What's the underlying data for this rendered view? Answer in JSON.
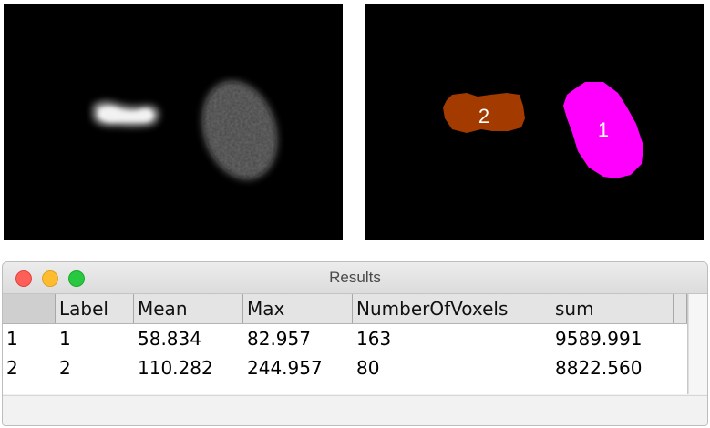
{
  "panels": {
    "raw": {
      "description_icon": "grayscale-image"
    },
    "labels": {
      "objects": [
        {
          "label": "2",
          "color": "#a33a00"
        },
        {
          "label": "1",
          "color": "#ff00ff"
        }
      ]
    }
  },
  "window": {
    "title": "Results",
    "buttons": {
      "close_color": "#fe5f57",
      "minimize_color": "#febc2e",
      "maximize_color": "#28c840"
    }
  },
  "table": {
    "columns": [
      "",
      "Label",
      "Mean",
      "Max",
      "NumberOfVoxels",
      "sum",
      ""
    ],
    "rows": [
      [
        "1",
        "1",
        "58.834",
        "82.957",
        "163",
        "9589.991"
      ],
      [
        "2",
        "2",
        "110.282",
        "244.957",
        "80",
        "8822.560"
      ]
    ]
  }
}
